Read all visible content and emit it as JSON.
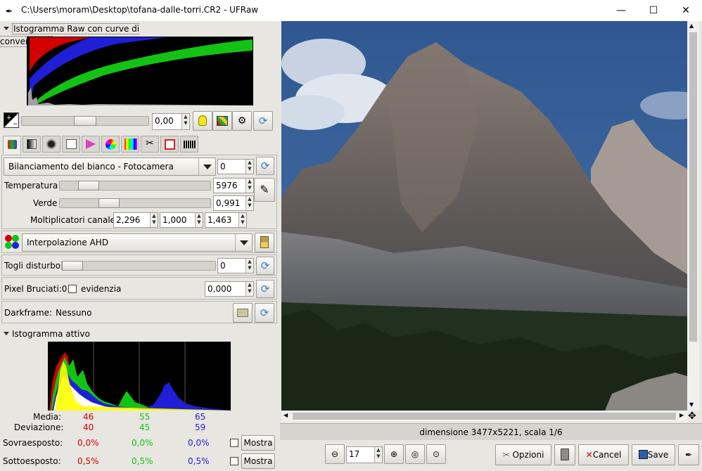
{
  "window": {
    "title": "C:\\Users\\moram\\Desktop\\tofana-dalle-torri.CR2 - UFRaw",
    "minimize": "—",
    "maximize": "☐",
    "close": "✕"
  },
  "raw_histogram": {
    "header": "Istogramma Raw con curve di conversione"
  },
  "exposure": {
    "value": "0,00"
  },
  "white_balance": {
    "preset": "Bilanciamento del bianco - Fotocamera",
    "preset_value": "0",
    "temperature_label": "Temperatura",
    "temperature_value": "5976",
    "temperature_level": 0.14,
    "green_label": "Verde",
    "green_value": "0,991",
    "green_level": 0.3,
    "multipliers_label": "Moltiplicatori canale:",
    "multipliers": [
      "2,296",
      "1,000",
      "1,463"
    ]
  },
  "interpolation": {
    "value": "Interpolazione AHD"
  },
  "denoise": {
    "label": "Togli disturbo",
    "value": "0",
    "level": 0.0
  },
  "hot_pixels": {
    "label": "Pixel Bruciati:0",
    "checkbox_label": "evidenzia",
    "value": "0,000"
  },
  "darkframe": {
    "label": "Darkframe:",
    "value": "Nessuno"
  },
  "live_histogram": {
    "header": "Istogramma attivo",
    "media_label": "Media:",
    "media": [
      "46",
      "55",
      "65"
    ],
    "deviation_label": "Deviazione:",
    "deviation": [
      "40",
      "45",
      "59"
    ],
    "over_label": "Sovraesposto:",
    "over": [
      "0,0%",
      "0,0%",
      "0,0%"
    ],
    "under_label": "Sottoesposto:",
    "under": [
      "0,5%",
      "0,5%",
      "0,5%"
    ],
    "show_label": "Mostra"
  },
  "preview": {
    "info": "dimensione 3477x5221, scala 1/6"
  },
  "toolbar": {
    "zoom_value": "17",
    "options_label": "Opzioni",
    "cancel_label": "Cancel",
    "save_label": "Save"
  },
  "colors": {
    "red": "#d40000",
    "green": "#13c313",
    "blue": "#1f1fd8",
    "sky": "#3a5e98"
  }
}
